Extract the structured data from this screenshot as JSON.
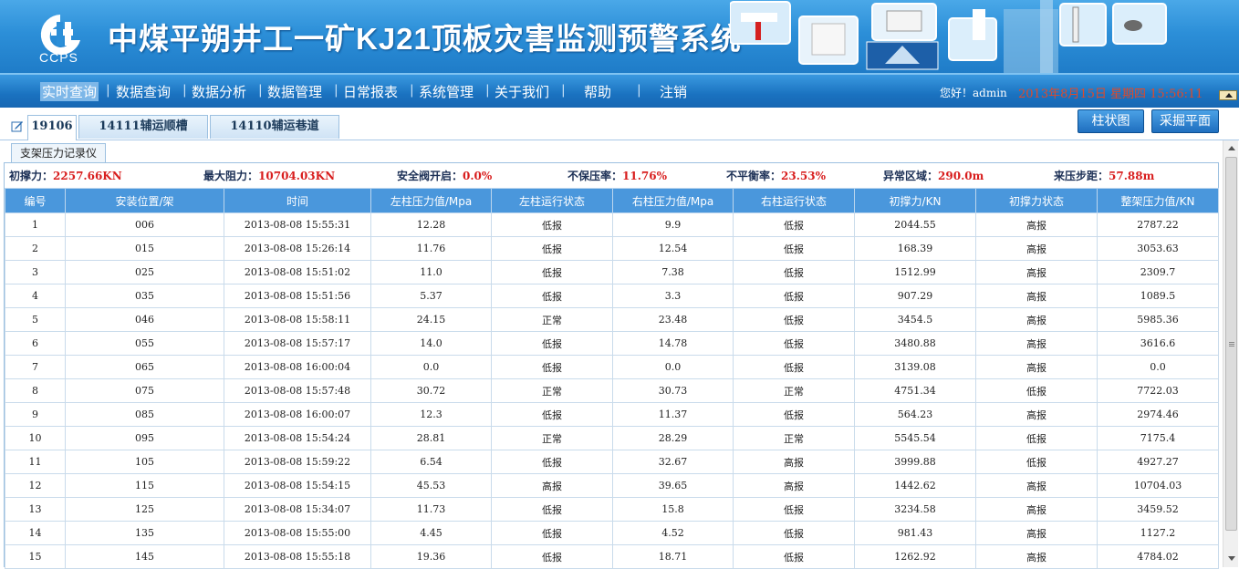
{
  "header": {
    "logo_text": "CCPS",
    "title": "中煤平朔井工一矿KJ21顶板灾害监测预警系统"
  },
  "nav": {
    "items": [
      {
        "label": "实时查询",
        "active": true
      },
      {
        "label": "数据查询"
      },
      {
        "label": "数据分析"
      },
      {
        "label": "数据管理"
      },
      {
        "label": "日常报表"
      },
      {
        "label": "系统管理"
      },
      {
        "label": "关于我们"
      },
      {
        "label": "帮助"
      },
      {
        "label": "注销"
      }
    ],
    "greeting": "您好！admin",
    "datetime": "2013年8月15日  星期四  15:56:11"
  },
  "tabs": [
    {
      "label": "19106",
      "active": true
    },
    {
      "label": "14111辅运顺槽"
    },
    {
      "label": "14110辅运巷道"
    }
  ],
  "actions": {
    "bar_chart": "柱状图",
    "face_plan": "采掘平面"
  },
  "subtab": "支架压力记录仪",
  "stats": [
    {
      "label": "初撑力：",
      "value": "2257.66KN"
    },
    {
      "label": "最大阻力：",
      "value": "10704.03KN"
    },
    {
      "label": "安全阀开启：",
      "value": "0.0%"
    },
    {
      "label": "不保压率：",
      "value": "11.76%"
    },
    {
      "label": "不平衡率：",
      "value": "23.53%"
    },
    {
      "label": "异常区域：",
      "value": "290.0m"
    },
    {
      "label": "来压步距：",
      "value": "57.88m"
    }
  ],
  "table": {
    "columns": [
      "编号",
      "安装位置/架",
      "时间",
      "左柱压力值/Mpa",
      "左柱运行状态",
      "右柱压力值/Mpa",
      "右柱运行状态",
      "初撑力/KN",
      "初撑力状态",
      "整架压力值/KN"
    ],
    "rows": [
      [
        "1",
        "006",
        "2013-08-08 15:55:31",
        "12.28",
        "低报",
        "9.9",
        "低报",
        "2044.55",
        "高报",
        "2787.22"
      ],
      [
        "2",
        "015",
        "2013-08-08 15:26:14",
        "11.76",
        "低报",
        "12.54",
        "低报",
        "168.39",
        "高报",
        "3053.63"
      ],
      [
        "3",
        "025",
        "2013-08-08 15:51:02",
        "11.0",
        "低报",
        "7.38",
        "低报",
        "1512.99",
        "高报",
        "2309.7"
      ],
      [
        "4",
        "035",
        "2013-08-08 15:51:56",
        "5.37",
        "低报",
        "3.3",
        "低报",
        "907.29",
        "高报",
        "1089.5"
      ],
      [
        "5",
        "046",
        "2013-08-08 15:58:11",
        "24.15",
        "正常",
        "23.48",
        "低报",
        "3454.5",
        "高报",
        "5985.36"
      ],
      [
        "6",
        "055",
        "2013-08-08 15:57:17",
        "14.0",
        "低报",
        "14.78",
        "低报",
        "3480.88",
        "高报",
        "3616.6"
      ],
      [
        "7",
        "065",
        "2013-08-08 16:00:04",
        "0.0",
        "低报",
        "0.0",
        "低报",
        "3139.08",
        "高报",
        "0.0"
      ],
      [
        "8",
        "075",
        "2013-08-08 15:57:48",
        "30.72",
        "正常",
        "30.73",
        "正常",
        "4751.34",
        "低报",
        "7722.03"
      ],
      [
        "9",
        "085",
        "2013-08-08 16:00:07",
        "12.3",
        "低报",
        "11.37",
        "低报",
        "564.23",
        "高报",
        "2974.46"
      ],
      [
        "10",
        "095",
        "2013-08-08 15:54:24",
        "28.81",
        "正常",
        "28.29",
        "正常",
        "5545.54",
        "低报",
        "7175.4"
      ],
      [
        "11",
        "105",
        "2013-08-08 15:59:22",
        "6.54",
        "低报",
        "32.67",
        "高报",
        "3999.88",
        "低报",
        "4927.27"
      ],
      [
        "12",
        "115",
        "2013-08-08 15:54:15",
        "45.53",
        "高报",
        "39.65",
        "高报",
        "1442.62",
        "高报",
        "10704.03"
      ],
      [
        "13",
        "125",
        "2013-08-08 15:34:07",
        "11.73",
        "低报",
        "15.8",
        "低报",
        "3234.58",
        "高报",
        "3459.52"
      ],
      [
        "14",
        "135",
        "2013-08-08 15:55:00",
        "4.45",
        "低报",
        "4.52",
        "低报",
        "981.43",
        "高报",
        "1127.2"
      ],
      [
        "15",
        "145",
        "2013-08-08 15:55:18",
        "19.36",
        "低报",
        "18.71",
        "低报",
        "1262.92",
        "高报",
        "4784.02"
      ]
    ]
  },
  "colors": {
    "low": "#e8a200",
    "normal": "#0a7a0a",
    "high": "#b01818",
    "header_blue": "#4a97dc"
  },
  "icons": {
    "edit": "edit-icon",
    "logo": "ccps-logo-icon"
  }
}
